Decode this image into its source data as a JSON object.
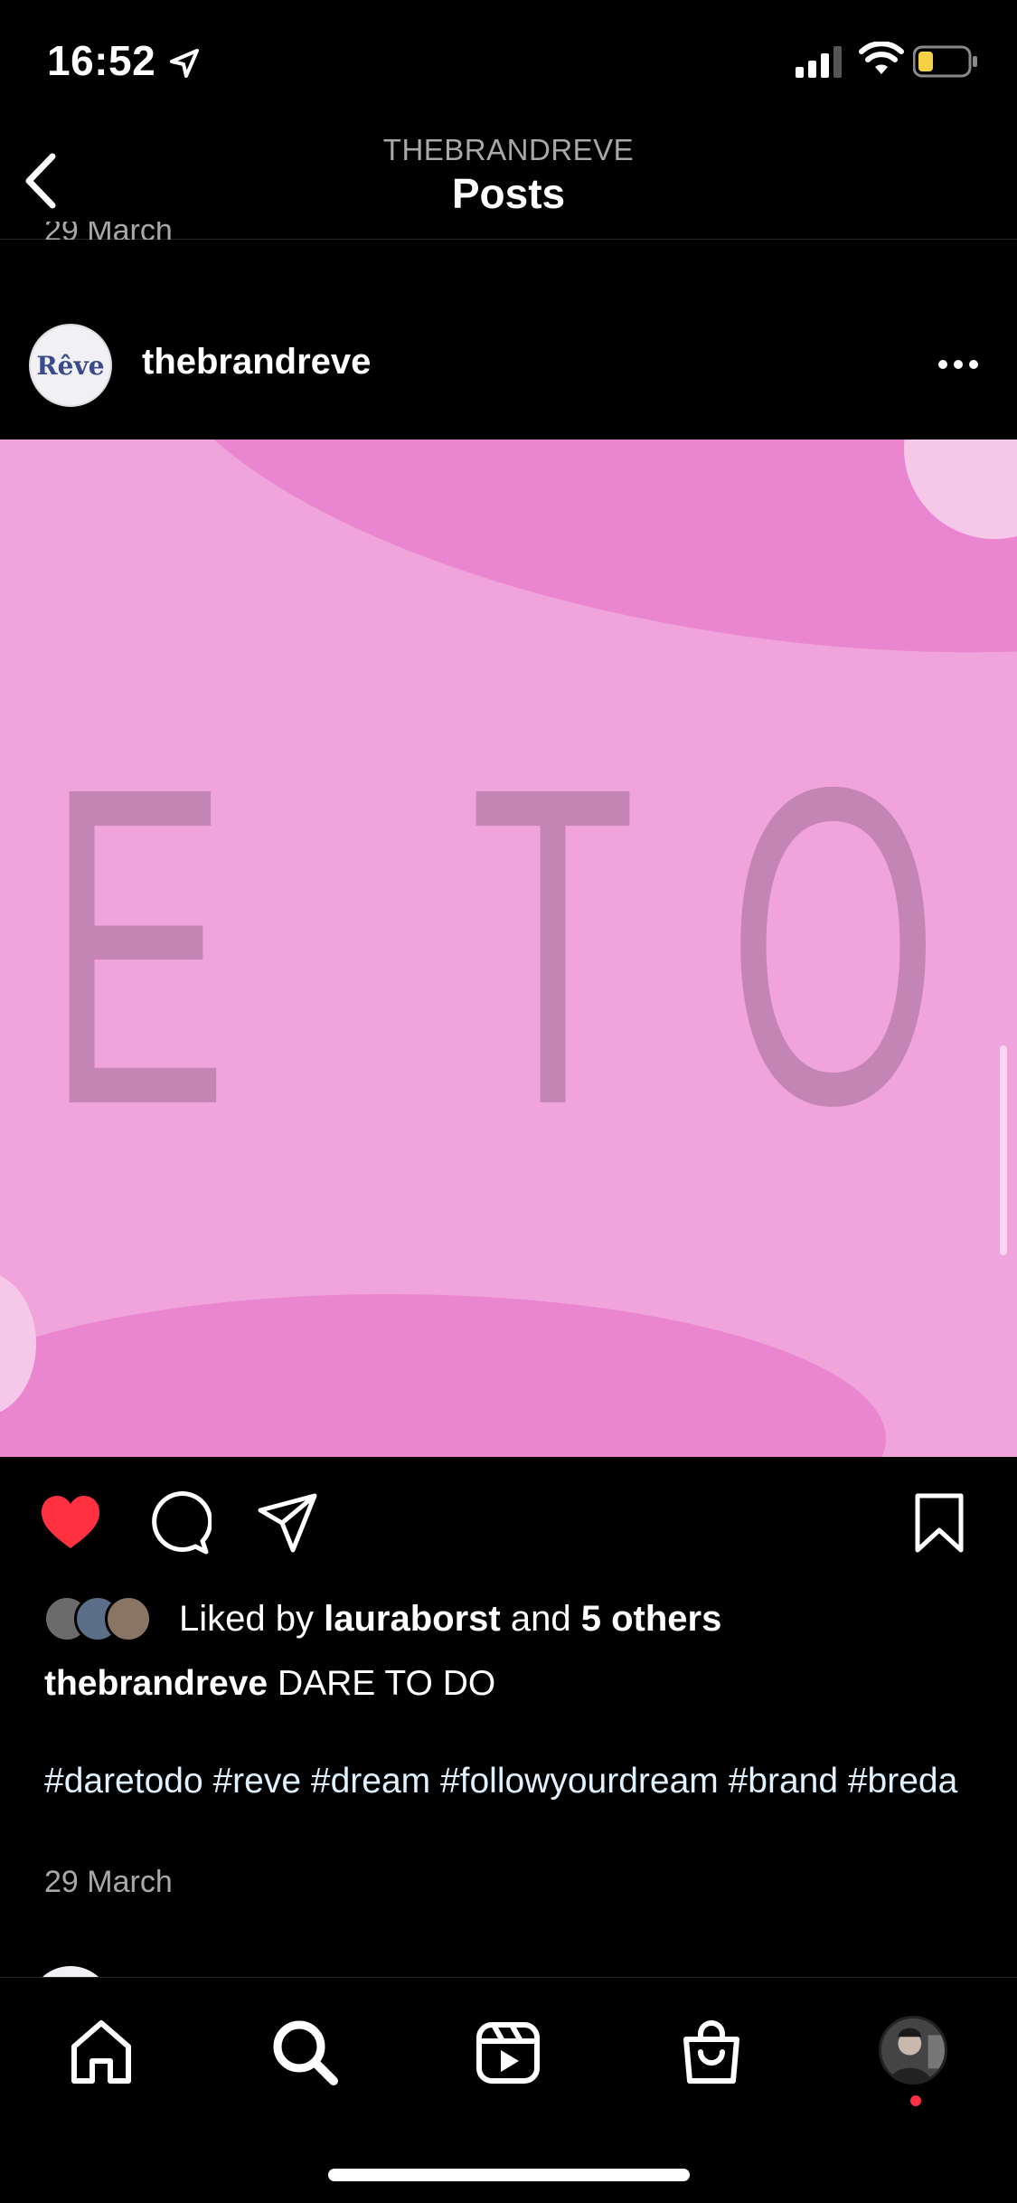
{
  "status_bar": {
    "time": "16:52",
    "icons": [
      "location-arrow-icon",
      "signal-icon",
      "wifi-icon",
      "battery-icon"
    ],
    "battery_color": "#f7d046"
  },
  "nav": {
    "subtitle": "THEBRANDREVE",
    "title": "Posts"
  },
  "previous_post": {
    "date": "29 March"
  },
  "post": {
    "avatar_text": "Rêve",
    "username": "thebrandreve",
    "image_letters": [
      "E",
      "T",
      "O"
    ],
    "colors": {
      "background": "#f0a4db",
      "blob": "#e986cf",
      "letters": "#c585b4"
    },
    "liked": true,
    "likes": {
      "prefix": "Liked by",
      "user": "lauraborst",
      "middle": "and",
      "others": "5 others"
    },
    "caption_user": "thebrandreve",
    "caption_text": "DARE TO DO",
    "hashtags": "#daretodo #reve #dream #followyourdream #brand #breda",
    "date": "29 March"
  },
  "tab_bar": {
    "items": [
      "home-icon",
      "search-icon",
      "reels-icon",
      "shop-icon",
      "profile-avatar"
    ],
    "notification_color": "#ff3040"
  }
}
